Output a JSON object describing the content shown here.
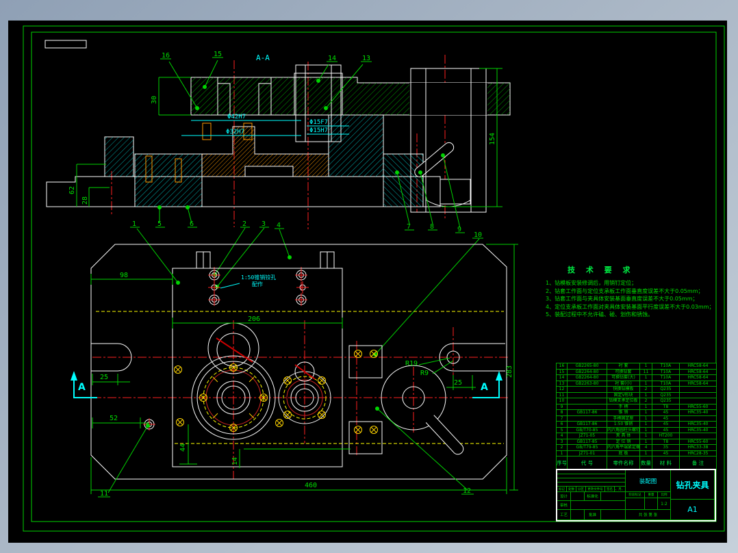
{
  "drawing": {
    "section_label": "A-A",
    "section_arrow": "A",
    "dims": {
      "d30": "30",
      "d62": "62",
      "d28": "28",
      "d154": "154",
      "d98": "98",
      "d206": "206",
      "d460": "460",
      "d283": "283",
      "d25_left": "25",
      "d25_right": "25",
      "d52": "52",
      "d44": "44",
      "d14": "14",
      "r19": "R19",
      "r9": "R9",
      "dia_left_top": "Φ42H7",
      "dia_left_bottom": "Φ32H7",
      "dia_center_top": "Φ15F7",
      "dia_center_bottom": "Φ15H7"
    },
    "note": {
      "line1": "1:50锥销铰孔",
      "line2": "配作"
    },
    "callouts": {
      "c1": "1",
      "c2": "2",
      "c3": "3",
      "c4": "4",
      "c5": "5",
      "c6": "6",
      "c7": "7",
      "c8": "8",
      "c9": "9",
      "c10": "10",
      "c11": "11",
      "c12": "12",
      "c13": "13",
      "c14": "14",
      "c15": "15",
      "c16": "16"
    }
  },
  "tech_requirements": {
    "title": "技 术 要 求",
    "items": [
      "1、钻模板安装修调后，用销钉定位；",
      "2、钻套工作面与定位支承板工作面垂直度误差不大于0.05mm；",
      "3、钻套工作面与夹具体安装基面垂直度误差不大于0.05mm；",
      "4、定位支承板工作面对夹具体安装基面平行度误差不大于0.03mm；",
      "5、装配过程中不允许磕、碰、划伤和锈蚀。"
    ]
  },
  "parts_list": {
    "headers": [
      "序号",
      "代  号",
      "零件名称",
      "数量",
      "材  料",
      "备  注"
    ],
    "rows": [
      [
        "16",
        "GB2265-80",
        "衬  套",
        "1",
        "T10A",
        "HRC58-64"
      ],
      [
        "15",
        "GB2264-80",
        "可换钻套",
        "11",
        "T10A",
        "HRC58-64"
      ],
      [
        "14",
        "GB2264-80",
        "可换钻套(大)",
        "1",
        "T10A",
        "HRC58-64"
      ],
      [
        "13",
        "GB2263-80",
        "衬 套(小)",
        "1",
        "T10A",
        "HRC58-64"
      ],
      [
        "12",
        "",
        "快换钻模板",
        "2",
        "Q235",
        ""
      ],
      [
        "11",
        "",
        "固定V形块",
        "1",
        "Q235",
        ""
      ],
      [
        "10",
        "",
        "钻模支承定位板",
        "2",
        "Q235",
        ""
      ],
      [
        "9",
        "",
        "手  柄",
        "1",
        "T8",
        "HRC55-60"
      ],
      [
        "8",
        "GB117-86",
        "锥  销",
        "1",
        "45",
        "HRC35-40"
      ],
      [
        "7",
        "",
        "手柄固定座",
        "1",
        "45",
        ""
      ],
      [
        "6",
        "GB117-86",
        "1:50 锥销",
        "1",
        "45",
        "HRC35-40"
      ],
      [
        "5",
        "GB/T70-85",
        "内六角圆柱头螺钉M10",
        "1",
        "45",
        "HRC35-40"
      ],
      [
        "4",
        "JZ71-05",
        "夹 具 体",
        "1",
        "HT200",
        ""
      ],
      [
        "3",
        "GB117-85",
        "定 位 销",
        "1",
        "T8",
        "HRC55-60"
      ],
      [
        "2",
        "GB/T79-85",
        "内六角平端紧定螺钉M8",
        "4",
        "35",
        "HRC33-38"
      ],
      [
        "1",
        "JZ71-01",
        "底  板",
        "1",
        "45",
        "HRC28-35"
      ]
    ]
  },
  "title_block": {
    "doc_type": "装配图",
    "title": "钻孔夹具",
    "sheet": "A1",
    "scale": "1:2",
    "labels": {
      "mark": "标记",
      "count": "处数",
      "zone": "分区",
      "change_file": "更改文件号",
      "sign": "签名",
      "date": "年、月、日",
      "design": "设计",
      "standardize": "标准化",
      "audit": "审核",
      "process": "工艺",
      "approve": "批准",
      "stage_mark": "阶段标记",
      "weight": "重量",
      "scale_label": "比例",
      "sheets": "共 张 第 张"
    }
  }
}
